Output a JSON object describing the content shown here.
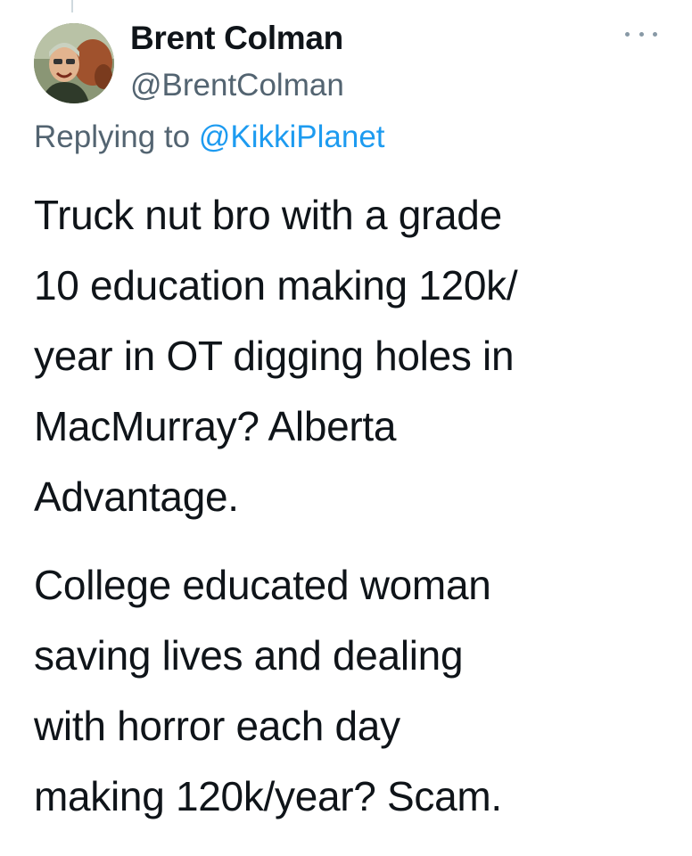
{
  "tweet": {
    "author": {
      "display_name": "Brent Colman",
      "handle": "@BrentColman",
      "avatar_icon": "profile-photo"
    },
    "more_icon": "ellipsis-icon",
    "replying_to": {
      "prefix": "Replying to",
      "mention": "@KikkiPlanet"
    },
    "paragraphs": [
      "Truck nut bro with a grade\n10 education making 120k/\nyear in OT digging holes in\nMacMurray? Alberta\nAdvantage.",
      "College educated woman\nsaving lives and dealing\nwith horror each day\nmaking 120k/year? Scam."
    ]
  },
  "colors": {
    "text": "#0f1419",
    "secondary": "#536471",
    "link": "#1d9bf0"
  }
}
